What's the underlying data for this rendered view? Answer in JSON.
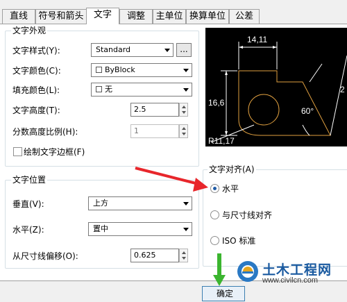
{
  "tabs": [
    {
      "label": "直线"
    },
    {
      "label": "符号和箭头"
    },
    {
      "label": "文字"
    },
    {
      "label": "调整"
    },
    {
      "label": "主单位"
    },
    {
      "label": "换算单位"
    },
    {
      "label": "公差"
    }
  ],
  "appearance": {
    "title": "文字外观",
    "style_label": "文字样式(Y):",
    "style_value": "Standard",
    "style_browse": "...",
    "color_label": "文字颜色(C):",
    "color_value": "ByBlock",
    "fill_label": "填充颜色(L):",
    "fill_value": "无",
    "height_label": "文字高度(T):",
    "height_value": "2.5",
    "fraction_label": "分数高度比例(H):",
    "fraction_value": "1",
    "frame_label": "绘制文字边框(F)"
  },
  "preview": {
    "dim_top": "14,11",
    "dim_left": "16,6",
    "dim_angle": "60°",
    "dim_radius": "R11,17",
    "dim_right_partial": "2"
  },
  "placement": {
    "title": "文字位置",
    "vertical_label": "垂直(V):",
    "vertical_value": "上方",
    "horizontal_label": "水平(Z):",
    "horizontal_value": "置中",
    "offset_label": "从尺寸线偏移(O):",
    "offset_value": "0.625"
  },
  "alignment": {
    "title": "文字对齐(A)",
    "options": [
      {
        "label": "水平",
        "checked": true
      },
      {
        "label": "与尺寸线对齐",
        "checked": false
      },
      {
        "label": "ISO 标准",
        "checked": false
      }
    ]
  },
  "buttons": {
    "ok_partial": "确定"
  },
  "watermark": {
    "brand": "土木工程网",
    "url": "www.civilcn.com"
  },
  "colors": {
    "annotation_arrow": "#e8262b",
    "annotation_arrow_green": "#3bb52f",
    "preview_line": "#e0a040",
    "preview_text": "#ffffff"
  }
}
